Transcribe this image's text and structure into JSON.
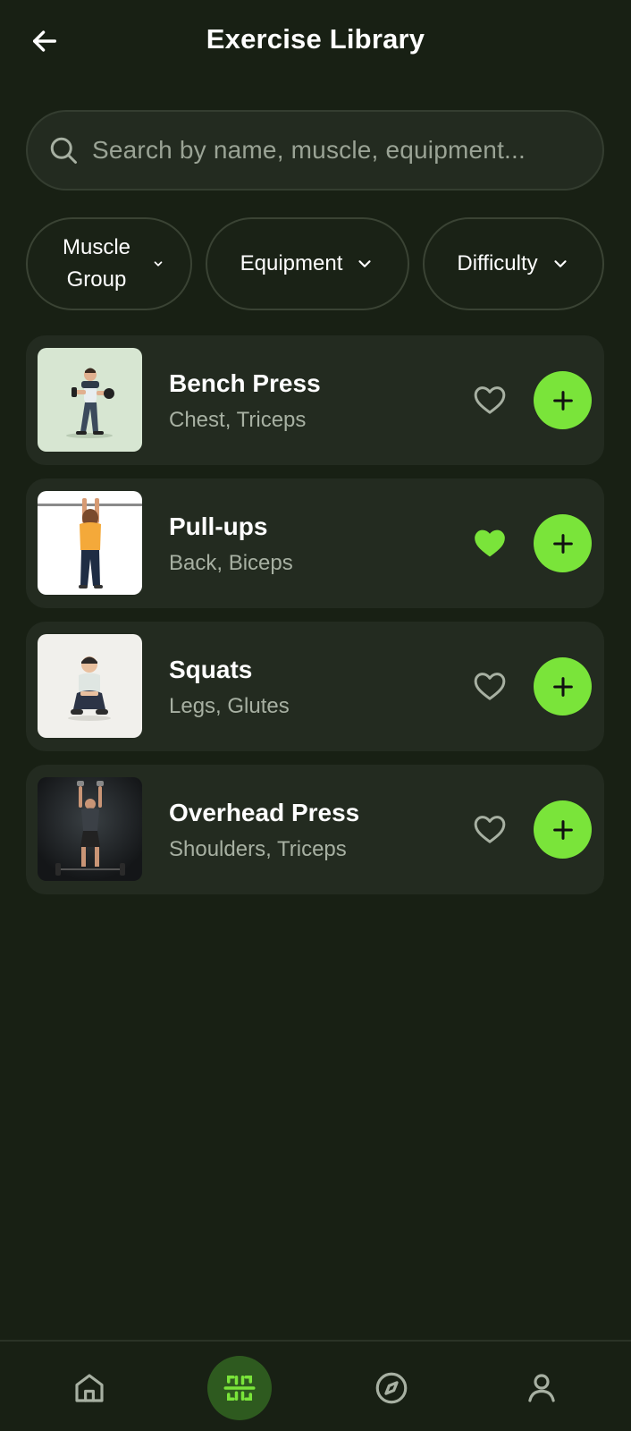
{
  "header": {
    "title": "Exercise Library",
    "back_icon": "arrow-left-icon"
  },
  "search": {
    "placeholder": "Search by name, muscle, equipment...",
    "value": ""
  },
  "filters": [
    {
      "label": "Muscle Group",
      "icon": "chevron-down-icon"
    },
    {
      "label": "Equipment",
      "icon": "chevron-down-icon"
    },
    {
      "label": "Difficulty",
      "icon": "chevron-down-icon"
    }
  ],
  "exercises": [
    {
      "name": "Bench Press",
      "muscles": "Chest, Triceps",
      "favorited": false
    },
    {
      "name": "Pull-ups",
      "muscles": "Back, Biceps",
      "favorited": true
    },
    {
      "name": "Squats",
      "muscles": "Legs, Glutes",
      "favorited": false
    },
    {
      "name": "Overhead Press",
      "muscles": "Shoulders, Triceps",
      "favorited": false
    }
  ],
  "bottom_nav": [
    {
      "icon": "home-icon",
      "active": false
    },
    {
      "icon": "library-scan-icon",
      "active": true
    },
    {
      "icon": "compass-icon",
      "active": false
    },
    {
      "icon": "profile-icon",
      "active": false
    }
  ],
  "colors": {
    "background": "#182014",
    "card": "#232b20",
    "accent": "#7ae43a",
    "muted_text": "#a7b0a2"
  }
}
